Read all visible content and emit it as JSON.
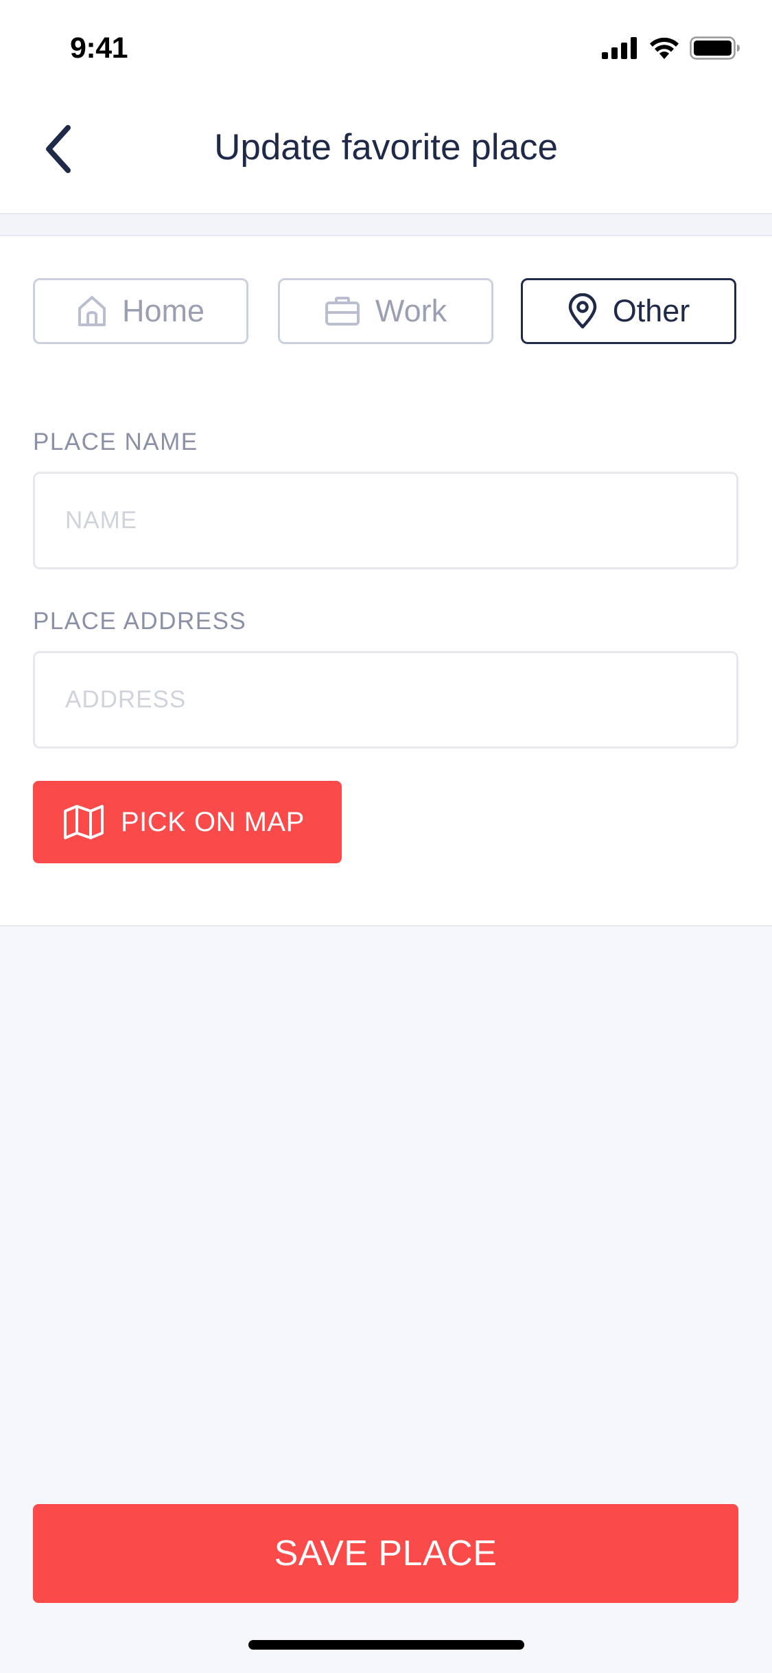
{
  "status_bar": {
    "time": "9:41"
  },
  "nav": {
    "title": "Update favorite place"
  },
  "place_types": [
    {
      "label": "Home",
      "icon": "home-icon",
      "selected": false
    },
    {
      "label": "Work",
      "icon": "briefcase-icon",
      "selected": false
    },
    {
      "label": "Other",
      "icon": "map-pin-icon",
      "selected": true
    }
  ],
  "form": {
    "name_label": "PLACE NAME",
    "name_value": "",
    "name_placeholder": "NAME",
    "address_label": "PLACE ADDRESS",
    "address_value": "",
    "address_placeholder": "ADDRESS",
    "pick_map_label": "PICK ON MAP"
  },
  "actions": {
    "save_label": "SAVE PLACE"
  },
  "colors": {
    "accent": "#FA4A4A",
    "text_dark": "#1E2A47",
    "muted": "#9AA0B2",
    "background": "#F6F7FB"
  }
}
